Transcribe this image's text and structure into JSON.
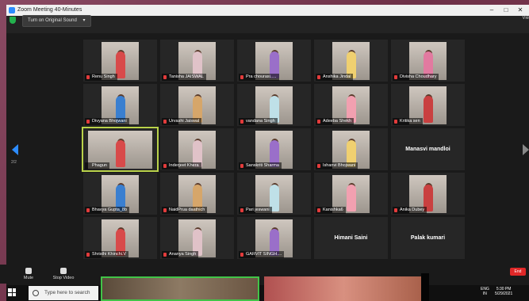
{
  "window": {
    "title": "Zoom Meeting 40-Minutes",
    "minimize": "–",
    "maximize": "□",
    "close": "✕"
  },
  "toprow": {
    "sound_button": "Turn on Original Sound",
    "sound_arrow": "▾",
    "view_label": "Vie"
  },
  "pager": {
    "page_left": "2/2"
  },
  "participants": [
    {
      "name": "Renu Singh",
      "muted": true
    },
    {
      "name": "Tanisha JAISWAL",
      "muted": true
    },
    {
      "name": "Pra chourasi.....",
      "muted": true
    },
    {
      "name": "Anshika Jindal",
      "muted": true
    },
    {
      "name": "Divisha Choudhary",
      "muted": true
    },
    {
      "name": "Divyana Bhojwani",
      "muted": true
    },
    {
      "name": "Urvashi Jaiswal",
      "muted": true
    },
    {
      "name": "vandana Singh",
      "muted": true
    },
    {
      "name": "Adeeba Shekh",
      "muted": true
    },
    {
      "name": "Kritika sen",
      "muted": true
    },
    {
      "name": "Phagun",
      "muted": false,
      "selected": true
    },
    {
      "name": "Inderjeet Khera",
      "muted": true
    },
    {
      "name": "Sanskriti Sharma",
      "muted": true
    },
    {
      "name": "Ishanvi Bhojwani",
      "muted": true
    },
    {
      "name": "Manasvi mandloi",
      "muted": false,
      "video": false
    },
    {
      "name": "Bhavya Gupta_8b",
      "muted": true
    },
    {
      "name": "NaidPrua daathich",
      "muted": true
    },
    {
      "name": "Pari jeswani",
      "muted": true
    },
    {
      "name": "Kanishka6",
      "muted": true
    },
    {
      "name": "Anika Dubey",
      "muted": true
    },
    {
      "name": "Shristhi Khinchi.V",
      "muted": true
    },
    {
      "name": "Ananya Singh",
      "muted": true
    },
    {
      "name": "GARVIT SINGH....",
      "muted": true
    },
    {
      "name": "Himani Saini",
      "muted": false,
      "video": false
    },
    {
      "name": "Palak kumari",
      "muted": false,
      "video": false
    }
  ],
  "toolbar": {
    "mute": "Mute",
    "stop_video": "Stop Video",
    "end": "End"
  },
  "taskbar": {
    "search_placeholder": "Type here to search",
    "lang_line1": "ENG",
    "lang_line2": "IN",
    "time": "5:30 PM",
    "date": "5/29/2021"
  },
  "colors": {
    "accent": "#2d8cff",
    "selected_outline": "#b9d24a",
    "end_red": "#e02828",
    "shield_green": "#23b14d"
  }
}
